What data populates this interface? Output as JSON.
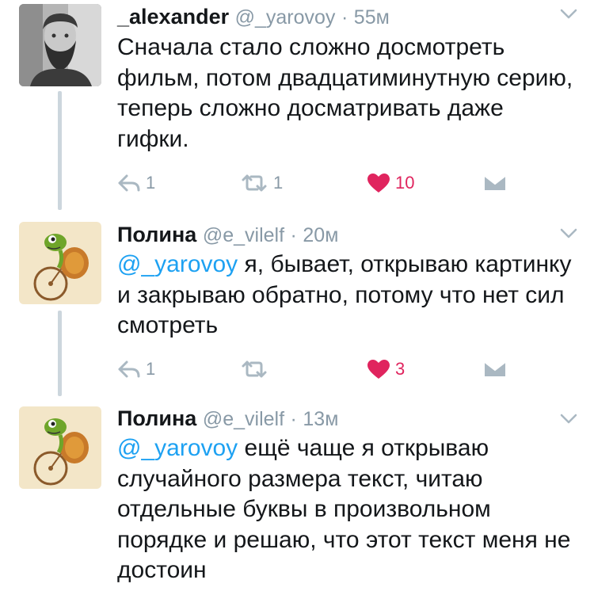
{
  "colors": {
    "accent": "#1da1f2",
    "like": "#e0245e",
    "muted": "#8899a6",
    "thread_line": "#ccd6dd"
  },
  "tweets": [
    {
      "name": "_alexander",
      "handle": "@_yarovoy",
      "separator": "·",
      "time": "55м",
      "mention": "",
      "text": "Сначала стало сложно досмотреть фильм, потом двадцатиминутную серию, теперь сложно досматривать даже гифки.",
      "reply_count": "1",
      "retweet_count": "1",
      "like_count": "10",
      "avatar_icon": "bearded-man-avatar"
    },
    {
      "name": "Полина",
      "handle": "@e_vilelf",
      "separator": "·",
      "time": "20м",
      "mention": "@_yarovoy",
      "text": " я, бывает, открываю картинку и закрываю обратно, потому что нет сил смотреть",
      "reply_count": "1",
      "retweet_count": "",
      "like_count": "3",
      "avatar_icon": "turtle-on-bicycle-avatar"
    },
    {
      "name": "Полина",
      "handle": "@e_vilelf",
      "separator": "·",
      "time": "13м",
      "mention": "@_yarovoy",
      "text": " ещё чаще я открываю случайного размера текст, читаю отдельные буквы в произвольном порядке и решаю, что этот текст меня не достоин",
      "avatar_icon": "turtle-on-bicycle-avatar"
    }
  ]
}
